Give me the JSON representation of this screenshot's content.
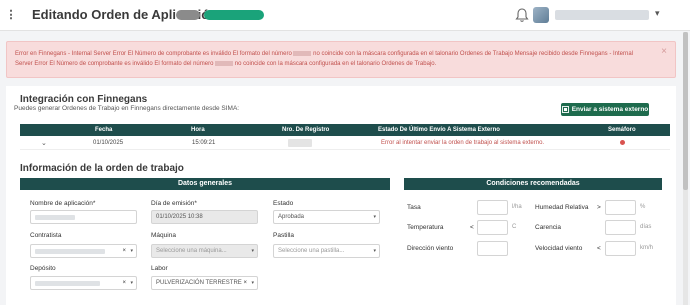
{
  "header": {
    "title": "Editando Orden de Aplicación",
    "menu_glyph": "⋮",
    "user_caret": "▾"
  },
  "alert": {
    "part1": "Error en Finnegans - Internal Server Error El Número de comprobante es inválido El formato del número",
    "part2": "no coincide con la máscara configurada en el talonario Ordenes de Trabajo Mensaje recibido desde Finnegans - Internal Server",
    "part3": "Error El Número de comprobante es inválido El formato del número",
    "part4": "no coincide con la máscara configurada en el talonario Ordenes de Trabajo.",
    "close": "×"
  },
  "integration": {
    "title": "Integración con Finnegans",
    "subtitle": "Puedes generar Ordenes de Trabajo en Finnegans directamente desde SIMA:",
    "button_label": "Enviar a sistema externo",
    "columns": [
      "Fecha",
      "Hora",
      "Nro. De Registro",
      "Estado De Último Envío A Sistema Externo",
      "Semáforo"
    ],
    "rows": [
      {
        "caret": "⌄",
        "fecha": "01/10/2025",
        "hora": "15:09:21",
        "estado": "Error al intentar enviar la orden de trabajo al sistema externo."
      }
    ]
  },
  "order_info": {
    "title": "Información de la orden de trabajo",
    "general_header": "Datos generales",
    "fields": {
      "nombre_label": "Nombre de aplicación*",
      "dia_label": "Día de emisión*",
      "dia_value": "01/10/2025 10:38",
      "estado_label": "Estado",
      "estado_value": "Aprobada",
      "contratista_label": "Contratista",
      "maquina_label": "Máquina",
      "maquina_placeholder": "Seleccione una máquina...",
      "pastilla_label": "Pastilla",
      "pastilla_placeholder": "Seleccione una pastilla...",
      "deposito_label": "Depósito",
      "labor_label": "Labor",
      "labor_value": "PULVERIZACIÓN TERRESTRE",
      "clear": "×",
      "caret": "▾"
    }
  },
  "conditions": {
    "header": "Condiciones recomendadas",
    "tasa_label": "Tasa",
    "tasa_unit": "l/ha",
    "humedad_label": "Humedad Relativa",
    "humedad_sym": ">",
    "humedad_unit": "%",
    "temp_label": "Temperatura",
    "temp_sym": "<",
    "temp_unit": "C",
    "carencia_label": "Carencia",
    "carencia_unit": "días",
    "direccion_label": "Dirección viento",
    "velocidad_label": "Velocidad viento",
    "velocidad_sym": "<",
    "velocidad_unit": "km/h"
  }
}
